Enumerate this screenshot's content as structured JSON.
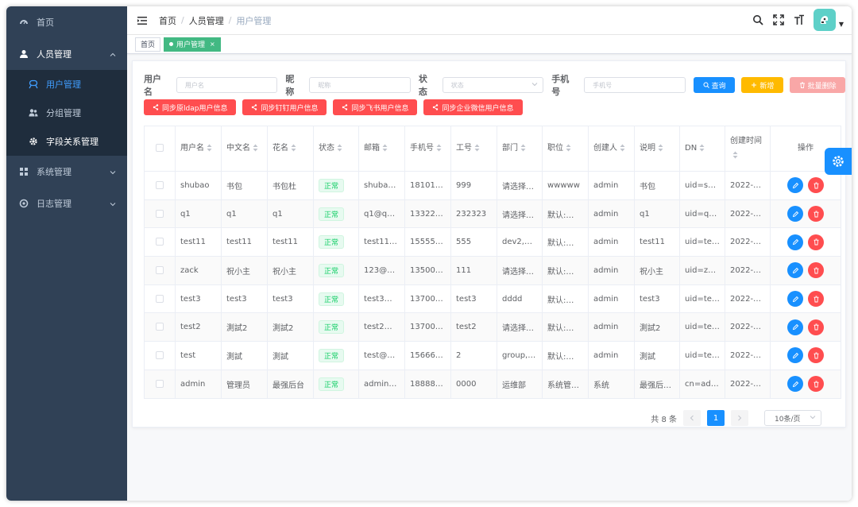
{
  "sidebar": {
    "home": "首页",
    "user_mgmt": "人员管理",
    "items": [
      {
        "label": "用户管理"
      },
      {
        "label": "分组管理"
      },
      {
        "label": "字段关系管理"
      }
    ],
    "system": "系统管理",
    "log": "日志管理"
  },
  "navbar": {
    "breadcrumb": [
      "首页",
      "人员管理",
      "用户管理"
    ],
    "sep": "/"
  },
  "tags": {
    "home": "首页",
    "active": "用户管理",
    "close": "×"
  },
  "filter": {
    "username_label": "用户名",
    "username_placeholder": "用户名",
    "nickname_label": "昵称",
    "nickname_placeholder": "昵称",
    "status_label": "状态",
    "status_placeholder": "状态",
    "phone_label": "手机号",
    "phone_placeholder": "手机号",
    "search_btn": "查询",
    "add_btn": "新增",
    "batch_delete_btn": "批量删除"
  },
  "sync_buttons": [
    "同步原ldap用户信息",
    "同步钉钉用户信息",
    "同步飞书用户信息",
    "同步企业微信用户信息"
  ],
  "table": {
    "headers": [
      "用户名",
      "中文名",
      "花名",
      "状态",
      "邮箱",
      "手机号",
      "工号",
      "部门",
      "职位",
      "创建人",
      "说明",
      "DN",
      "创建时间",
      "操作"
    ],
    "rows": [
      [
        "shubao",
        "书包",
        "书包杜",
        "正常",
        "shuba…",
        "18101…",
        "999",
        "请选择…",
        "wwwww",
        "admin",
        "书包",
        "uid=sh…",
        "2022-…"
      ],
      [
        "q1",
        "q1",
        "q1",
        "正常",
        "q1@qq…",
        "13322…",
        "232323",
        "请选择…",
        "默认:…",
        "admin",
        "q1",
        "uid=q1…",
        "2022-…"
      ],
      [
        "test11",
        "test11",
        "test11",
        "正常",
        "test11…",
        "15555…",
        "555",
        "dev2,d…",
        "默认:…",
        "admin",
        "test11",
        "uid=te…",
        "2022-…"
      ],
      [
        "zack",
        "祝小主",
        "祝小主",
        "正常",
        "123@a…",
        "13500…",
        "111",
        "请选择…",
        "默认:…",
        "admin",
        "祝小主",
        "uid=za…",
        "2022-…"
      ],
      [
        "test3",
        "test3",
        "test3",
        "正常",
        "test3@…",
        "13700…",
        "test3",
        "dddd",
        "默认:…",
        "admin",
        "test3",
        "uid=te…",
        "2022-…"
      ],
      [
        "test2",
        "測試2",
        "測試2",
        "正常",
        "test2@…",
        "13700…",
        "test2",
        "请选择…",
        "默认:…",
        "admin",
        "測試2",
        "uid=te…",
        "2022-…"
      ],
      [
        "test",
        "測試",
        "測試",
        "正常",
        "test@e…",
        "15666…",
        "2",
        "group,…",
        "默认:…",
        "admin",
        "測試",
        "uid=te…",
        "2022-…"
      ],
      [
        "admin",
        "管理员",
        "最强后台",
        "正常",
        "admin…",
        "18888…",
        "0000",
        "运维部",
        "系统管…",
        "系统",
        "最强后…",
        "cn=ad…",
        "2022-…"
      ]
    ]
  },
  "pager": {
    "total": "共 8 条",
    "current": "1",
    "size": "10条/页"
  },
  "colors": {
    "sidebar_bg": "#304156",
    "primary": "#1890ff",
    "danger": "#ff4d4f",
    "warning": "#ffba00",
    "success_tag": "#42b983"
  }
}
